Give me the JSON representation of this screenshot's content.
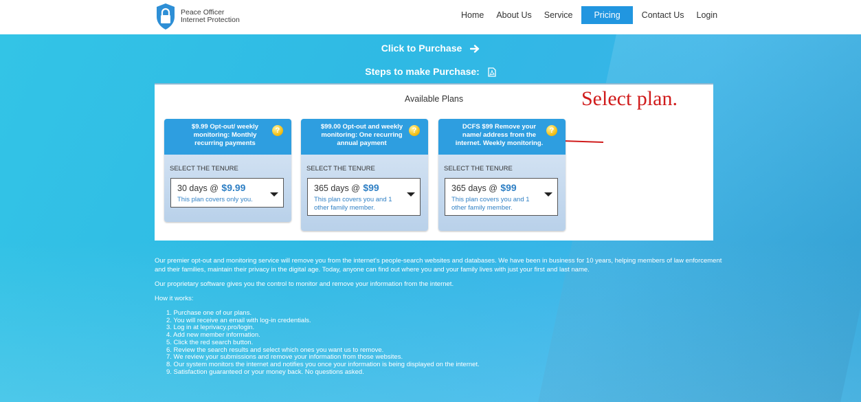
{
  "header": {
    "logo_line1": "Peace Officer",
    "logo_line2": "Internet Protection",
    "nav": [
      {
        "label": "Home",
        "active": false
      },
      {
        "label": "About Us",
        "active": false
      },
      {
        "label": "Service",
        "active": false
      },
      {
        "label": "Pricing",
        "active": true
      },
      {
        "label": "Contact Us",
        "active": false
      },
      {
        "label": "Login",
        "active": false
      }
    ]
  },
  "hero": {
    "purchase_label": "Click to Purchase",
    "steps_label": "Steps to make Purchase:"
  },
  "plans": {
    "title": "Available Plans",
    "annotation": "Select plan.",
    "tenure_label": "SELECT THE TENURE",
    "items": [
      {
        "name": "$9.99 Opt-out/ weekly monitoring: Monthly recurring payments",
        "days": "30 days @",
        "price": "$9.99",
        "covers": "This plan covers only you."
      },
      {
        "name": "$99.00 Opt-out and weekly monitoring: One recurring annual payment",
        "days": "365 days @",
        "price": "$99",
        "covers": "This plan covers you and 1 other family member."
      },
      {
        "name": "DCFS $99 Remove your name/ address from the internet. Weekly monitoring.",
        "days": "365 days @",
        "price": "$99",
        "covers": "This plan covers you and 1 other family member."
      }
    ]
  },
  "copy": {
    "para1": "Our premier opt-out and monitoring service will remove you from the internet's people-search websites and databases. We have been in business for 10 years, helping members of law enforcement and their families, maintain their privacy in the digital age. Today, anyone can find out where you and your family lives with just your first and last name.",
    "para2": "Our proprietary software gives you the control to monitor and remove your information from the internet.",
    "how": "How it works:",
    "steps": [
      "1. Purchase one of our plans.",
      "2. You will receive an email with log-in credentials.",
      "3. Log in at leprivacy.pro/login.",
      "4. Add new member information.",
      "5. Click the red search button.",
      "6. Review the search results and select which ones you want us to remove.",
      "7. We review your submissions and remove your information from those websites.",
      "8. Our system monitors the internet and notifies you once your information is being displayed on the internet.",
      "9. Satisfaction guaranteed or your money back. No questions asked."
    ]
  },
  "colors": {
    "accent": "#2196e0",
    "plan_header": "#2e9ee0",
    "price": "#2e7fc4",
    "annotation": "#d01b1b"
  }
}
